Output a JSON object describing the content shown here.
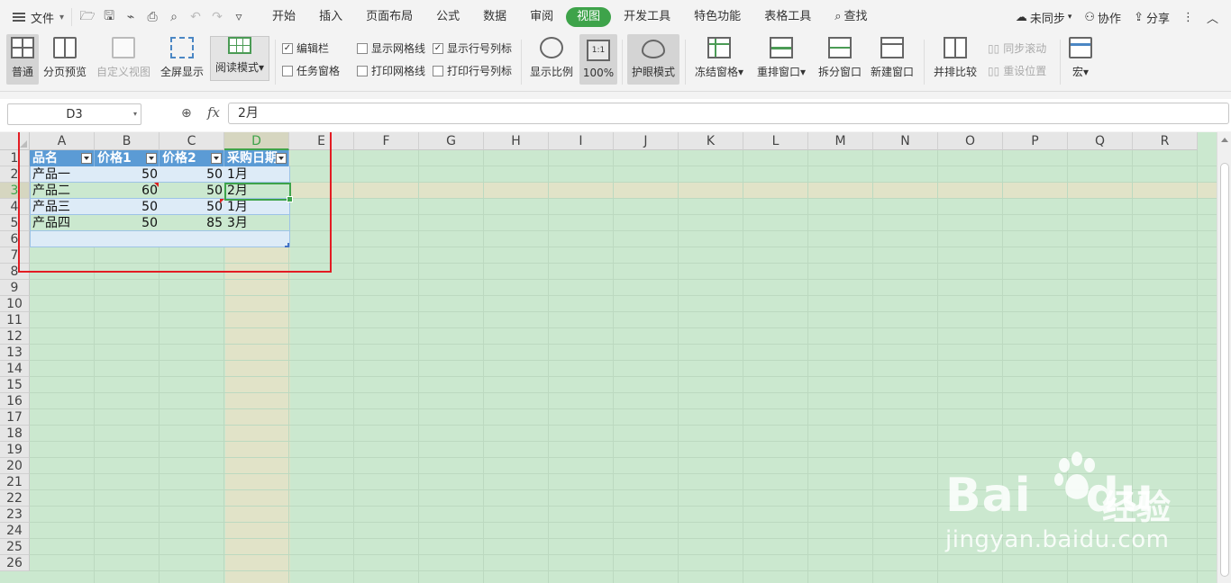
{
  "menubar": {
    "file_label": "文件",
    "tabs": [
      "开始",
      "插入",
      "页面布局",
      "公式",
      "数据",
      "审阅",
      "视图",
      "开发工具",
      "特色功能",
      "表格工具"
    ],
    "active_tab": "视图",
    "search_label": "查找",
    "sync_label": "未同步",
    "collab_label": "协作",
    "share_label": "分享"
  },
  "ribbon": {
    "normal": "普通",
    "page_preview": "分页预览",
    "custom_view": "自定义视图",
    "fullscreen": "全屏显示",
    "reading_mode": "阅读模式",
    "edit_bar": "编辑栏",
    "task_pane": "任务窗格",
    "show_gridlines": "显示网格线",
    "print_gridlines": "打印网格线",
    "show_headers": "显示行号列标",
    "print_headers": "打印行号列标",
    "zoom": "显示比例",
    "hundred": "100%",
    "one_to_one": "1:1",
    "eye_mode": "护眼模式",
    "freeze": "冻结窗格",
    "rearrange": "重排窗口",
    "split": "拆分窗口",
    "new_window": "新建窗口",
    "side_by_side": "并排比较",
    "sync_scroll": "同步滚动",
    "reset_position": "重设位置",
    "macro": "宏"
  },
  "formula": {
    "name_box": "D3",
    "fx": "fx",
    "value": "2月"
  },
  "sheet": {
    "columns": [
      "A",
      "B",
      "C",
      "D",
      "E",
      "F",
      "G",
      "H",
      "I",
      "J",
      "K",
      "L",
      "M",
      "N",
      "O",
      "P",
      "Q",
      "R"
    ],
    "rows": [
      "1",
      "2",
      "3",
      "4",
      "5",
      "6",
      "7",
      "8",
      "9",
      "10",
      "11",
      "12",
      "13",
      "14",
      "15",
      "16",
      "17",
      "18",
      "19",
      "20",
      "21",
      "22",
      "23",
      "24",
      "25",
      "26"
    ],
    "headers": [
      "品名",
      "价格1",
      "价格2",
      "采购日期"
    ],
    "data": [
      [
        "产品一",
        "50",
        "50",
        "1月"
      ],
      [
        "产品二",
        "60",
        "50",
        "2月"
      ],
      [
        "产品三",
        "50",
        "50",
        "1月"
      ],
      [
        "产品四",
        "50",
        "85",
        "3月"
      ]
    ]
  },
  "watermark": {
    "brand": "Bai",
    "brand2": "du",
    "cn": "经验",
    "url": "jingyan.baidu.com"
  },
  "colors": {
    "accent": "#3ea34a",
    "eye_background": "#cbe8cf",
    "table_header": "#5b9bd5",
    "highlight_box": "#e31c23"
  }
}
